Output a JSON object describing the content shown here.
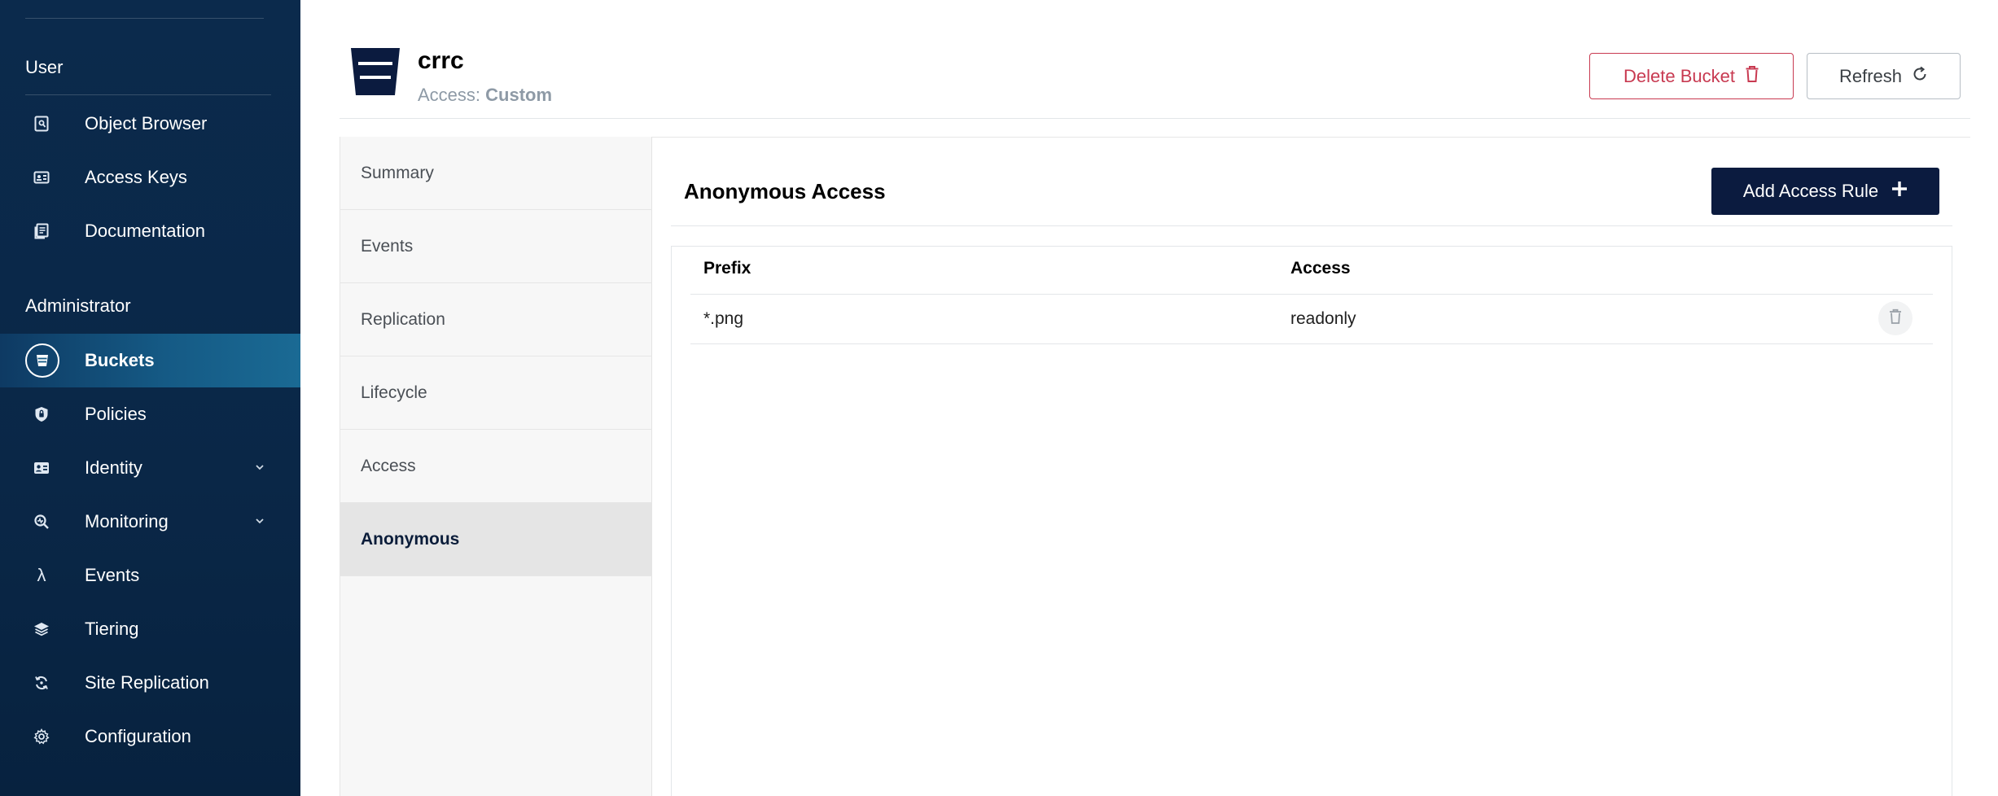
{
  "sidebar": {
    "sections": [
      {
        "title": "User",
        "items": [
          {
            "label": "Object Browser",
            "icon": "object-browser-icon"
          },
          {
            "label": "Access Keys",
            "icon": "access-keys-icon"
          },
          {
            "label": "Documentation",
            "icon": "documentation-icon"
          }
        ]
      },
      {
        "title": "Administrator",
        "items": [
          {
            "label": "Buckets",
            "icon": "bucket-icon",
            "active": true
          },
          {
            "label": "Policies",
            "icon": "policies-icon"
          },
          {
            "label": "Identity",
            "icon": "identity-icon",
            "expandable": true
          },
          {
            "label": "Monitoring",
            "icon": "monitoring-icon",
            "expandable": true
          },
          {
            "label": "Events",
            "icon": "lambda-icon"
          },
          {
            "label": "Tiering",
            "icon": "tiering-icon"
          },
          {
            "label": "Site Replication",
            "icon": "site-replication-icon"
          },
          {
            "label": "Configuration",
            "icon": "configuration-icon"
          }
        ]
      }
    ]
  },
  "header": {
    "bucket_name": "crrc",
    "access_label": "Access:",
    "access_value": "Custom",
    "delete_label": "Delete Bucket",
    "refresh_label": "Refresh"
  },
  "tabs": [
    {
      "label": "Summary"
    },
    {
      "label": "Events"
    },
    {
      "label": "Replication"
    },
    {
      "label": "Lifecycle"
    },
    {
      "label": "Access"
    },
    {
      "label": "Anonymous",
      "active": true
    }
  ],
  "panel": {
    "title": "Anonymous Access",
    "add_label": "Add Access Rule",
    "columns": [
      "Prefix",
      "Access"
    ],
    "rows": [
      {
        "prefix": "*.png",
        "access": "readonly"
      }
    ]
  },
  "colors": {
    "sidebar_bg": "#0b2a4c",
    "primary_button": "#0b1b3f",
    "danger": "#c83a51"
  }
}
